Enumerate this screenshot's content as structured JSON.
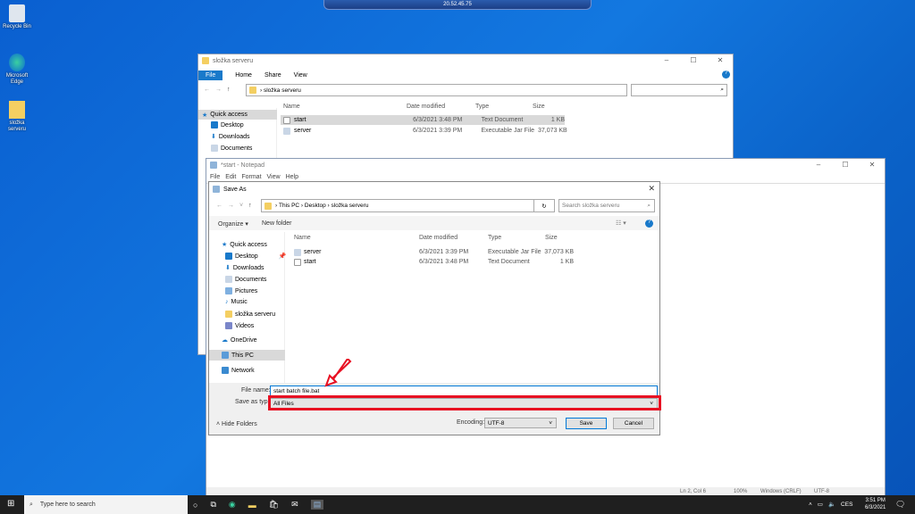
{
  "remote_bar": {
    "host": "20.52.45.75"
  },
  "desktop_icons": [
    {
      "label": "Recycle Bin"
    },
    {
      "label": "Microsoft Edge"
    },
    {
      "label": "složka serveru"
    }
  ],
  "explorer": {
    "title": "složka serveru",
    "ribbon_tabs": [
      "File",
      "Home",
      "Share",
      "View"
    ],
    "address": "složka serveru",
    "columns": [
      "Name",
      "Date modified",
      "Type",
      "Size"
    ],
    "files": [
      {
        "name": "start",
        "date": "6/3/2021 3:48 PM",
        "type": "Text Document",
        "size": "1 KB"
      },
      {
        "name": "server",
        "date": "6/3/2021 3:39 PM",
        "type": "Executable Jar File",
        "size": "37,073 KB"
      }
    ],
    "nav": [
      "Quick access",
      "Desktop",
      "Downloads",
      "Documents"
    ]
  },
  "notepad": {
    "title": "*start - Notepad",
    "menu": [
      "File",
      "Edit",
      "Format",
      "View",
      "Help"
    ],
    "status": {
      "position": "Ln 2, Col 6",
      "zoom": "100%",
      "line_endings": "Windows (CRLF)",
      "encoding": "UTF-8"
    }
  },
  "save_as": {
    "title": "Save As",
    "breadcrumb": [
      "This PC",
      "Desktop",
      "složka serveru"
    ],
    "search_placeholder": "Search složka serveru",
    "organize": "Organize ▾",
    "new_folder": "New folder",
    "columns": [
      "Name",
      "Date modified",
      "Type",
      "Size"
    ],
    "files": [
      {
        "name": "server",
        "date": "6/3/2021 3:39 PM",
        "type": "Executable Jar File",
        "size": "37,073 KB"
      },
      {
        "name": "start",
        "date": "6/3/2021 3:48 PM",
        "type": "Text Document",
        "size": "1 KB"
      }
    ],
    "nav": [
      "Quick access",
      "Desktop",
      "Downloads",
      "Documents",
      "Pictures",
      "Music",
      "složka serveru",
      "Videos",
      "OneDrive",
      "This PC",
      "Network"
    ],
    "file_name_label": "File name:",
    "file_name": "start batch file.bat",
    "save_type_label": "Save as type:",
    "save_type": "All Files",
    "hide_folders": "Hide Folders",
    "encoding_label": "Encoding:",
    "encoding": "UTF-8",
    "save": "Save",
    "cancel": "Cancel"
  },
  "taskbar": {
    "search_placeholder": "Type here to search",
    "time": "3:51 PM",
    "date": "6/3/2021",
    "language": "CES"
  },
  "colors": {
    "highlight": "#e81123",
    "accent": "#0063b1"
  }
}
